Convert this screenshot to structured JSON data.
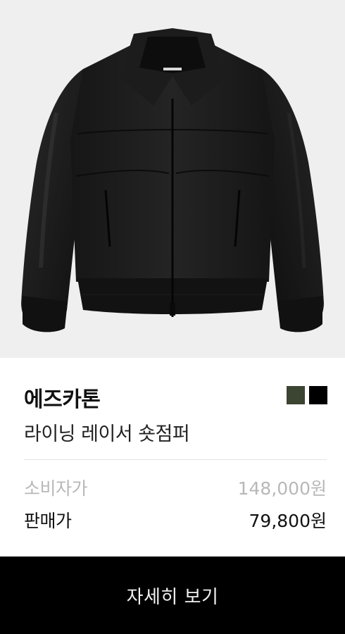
{
  "product": {
    "image_alt": "black blouson jacket",
    "brand": "에즈카톤",
    "name": "라이닝 레이서 숏점퍼",
    "colors": [
      "#3c4432",
      "#000000"
    ]
  },
  "pricing": {
    "retail_label": "소비자가",
    "retail_value": "148,000원",
    "sale_label": "판매가",
    "sale_value": "79,800원"
  },
  "actions": {
    "detail_label": "자세히 보기"
  },
  "theme": {
    "image_bg": "#efefef",
    "button_bg": "#000000",
    "muted_text": "#b8b8b8"
  }
}
